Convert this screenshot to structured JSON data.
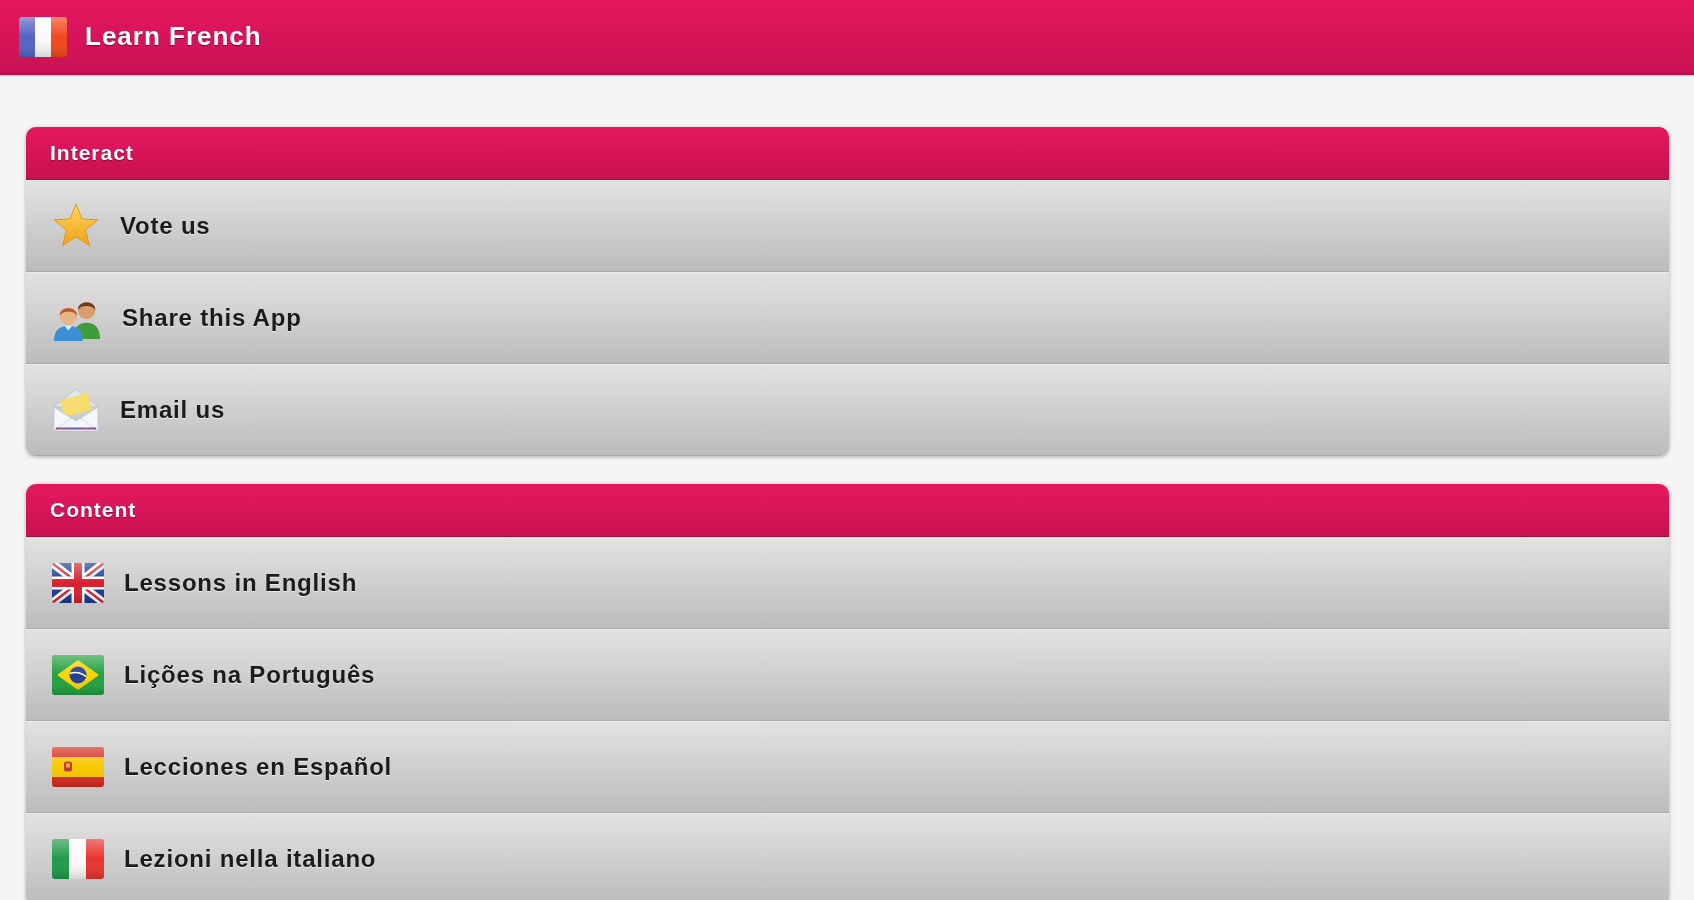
{
  "app_bar": {
    "title": "Learn French"
  },
  "sections": [
    {
      "title": "Interact",
      "items": [
        {
          "label": "Vote us"
        },
        {
          "label": "Share this App"
        },
        {
          "label": "Email us"
        }
      ]
    },
    {
      "title": "Content",
      "items": [
        {
          "label": "Lessons in English"
        },
        {
          "label": "Lições na Português"
        },
        {
          "label": "Lecciones en Español"
        },
        {
          "label": "Lezioni nella italiano"
        }
      ]
    }
  ]
}
